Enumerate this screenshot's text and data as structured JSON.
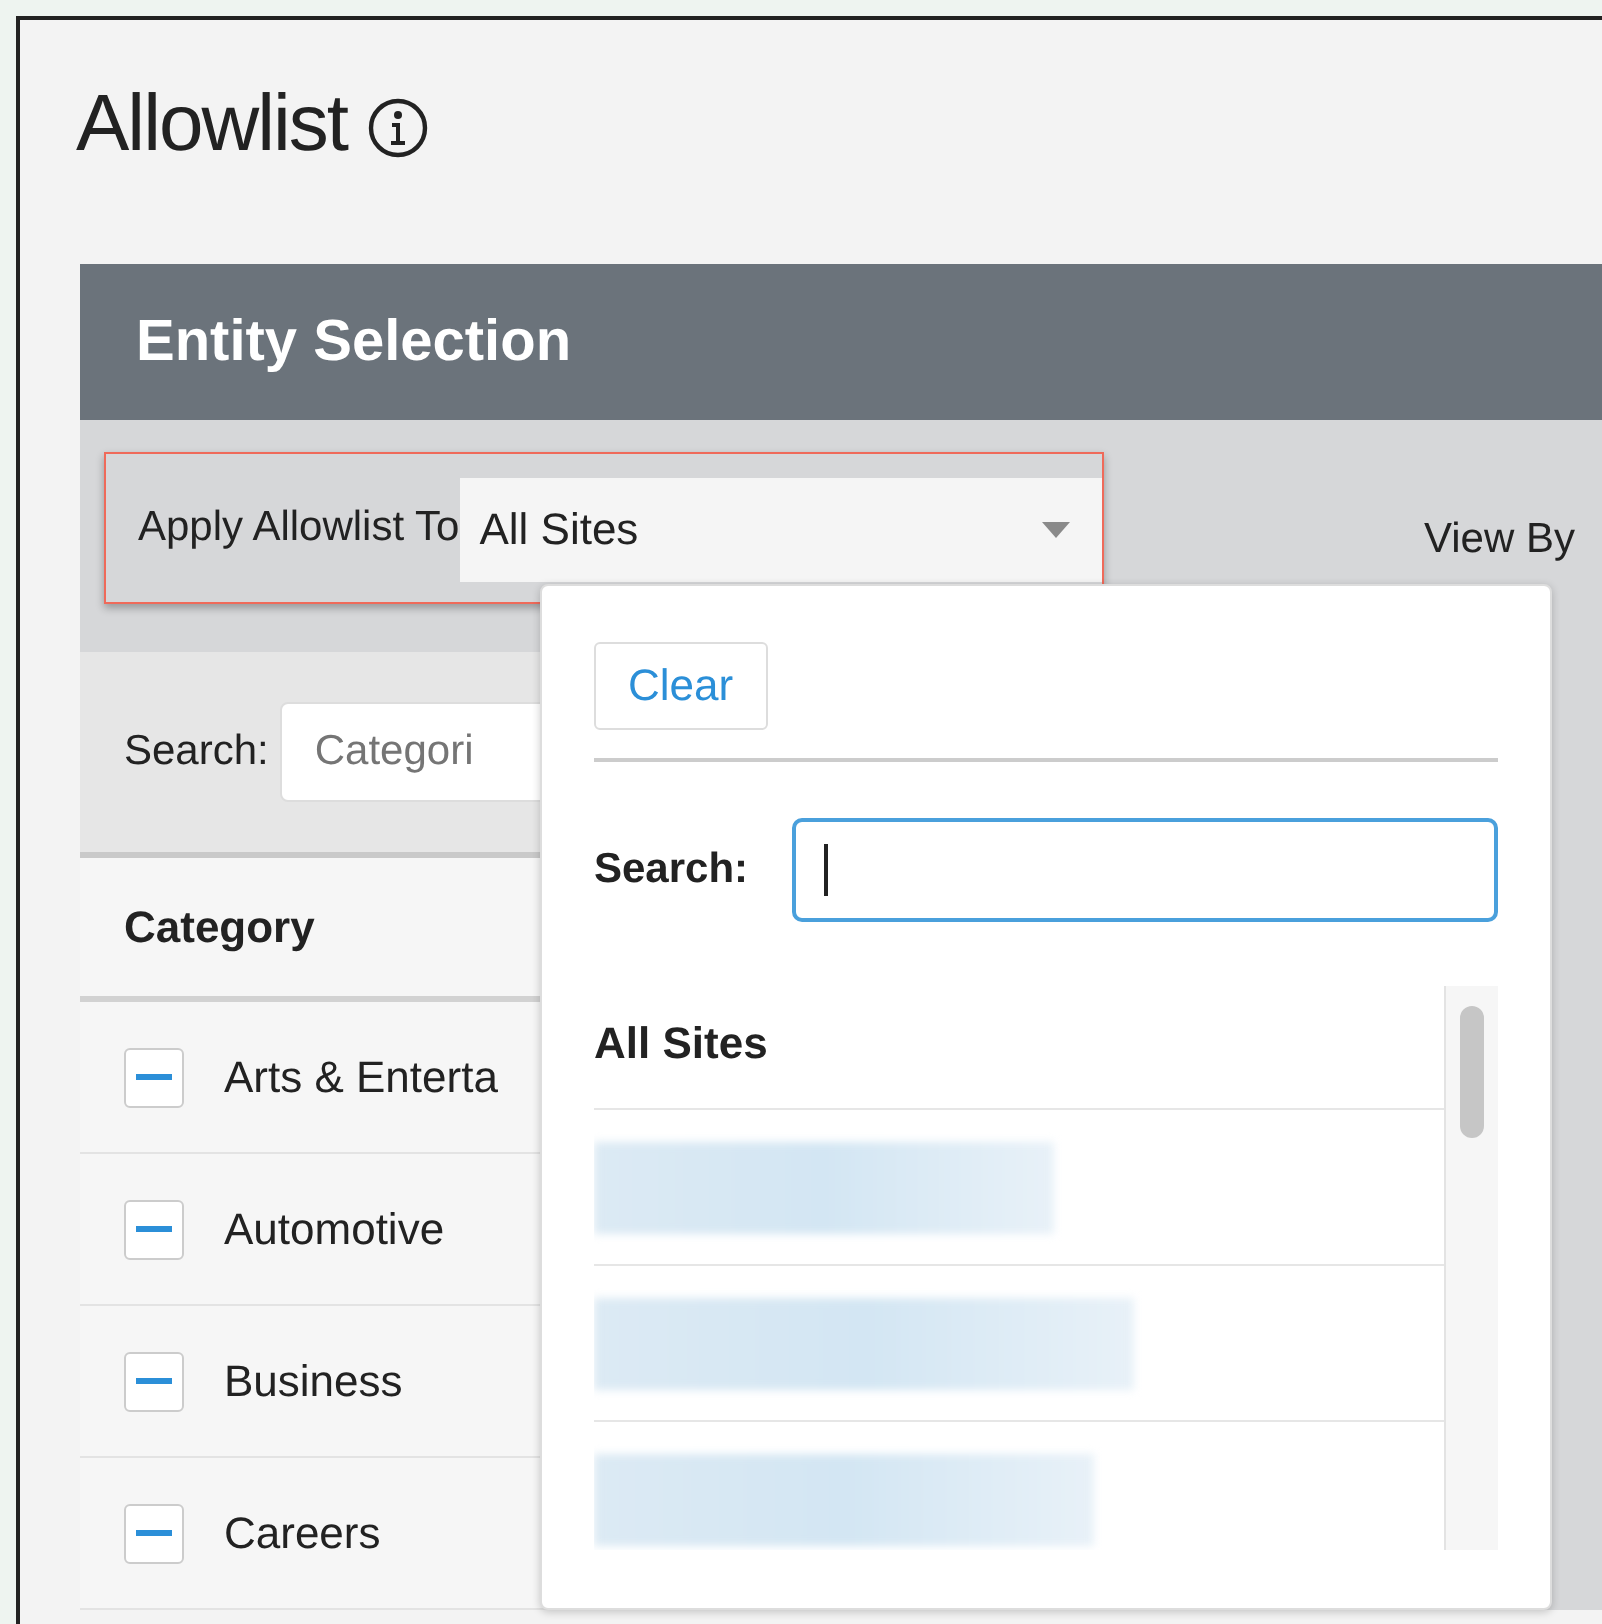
{
  "page": {
    "title": "Allowlist"
  },
  "panel": {
    "title": "Entity Selection",
    "apply_label": "Apply Allowlist To",
    "apply_value": "All Sites",
    "view_by_label": "View By"
  },
  "category_list": {
    "search_label": "Search:",
    "search_placeholder": "Categori",
    "column": "Category",
    "rows": [
      {
        "name": "Arts & Enterta",
        "excluded": true
      },
      {
        "name": "Automotive",
        "excluded": true
      },
      {
        "name": "Business",
        "excluded": true
      },
      {
        "name": "Careers",
        "excluded": true
      }
    ]
  },
  "dropdown": {
    "clear_button": "Clear",
    "search_label": "Search:",
    "options": [
      {
        "kind": "heading",
        "label": "All Sites"
      },
      {
        "kind": "blurred"
      },
      {
        "kind": "blurred"
      },
      {
        "kind": "blurred"
      }
    ]
  }
}
